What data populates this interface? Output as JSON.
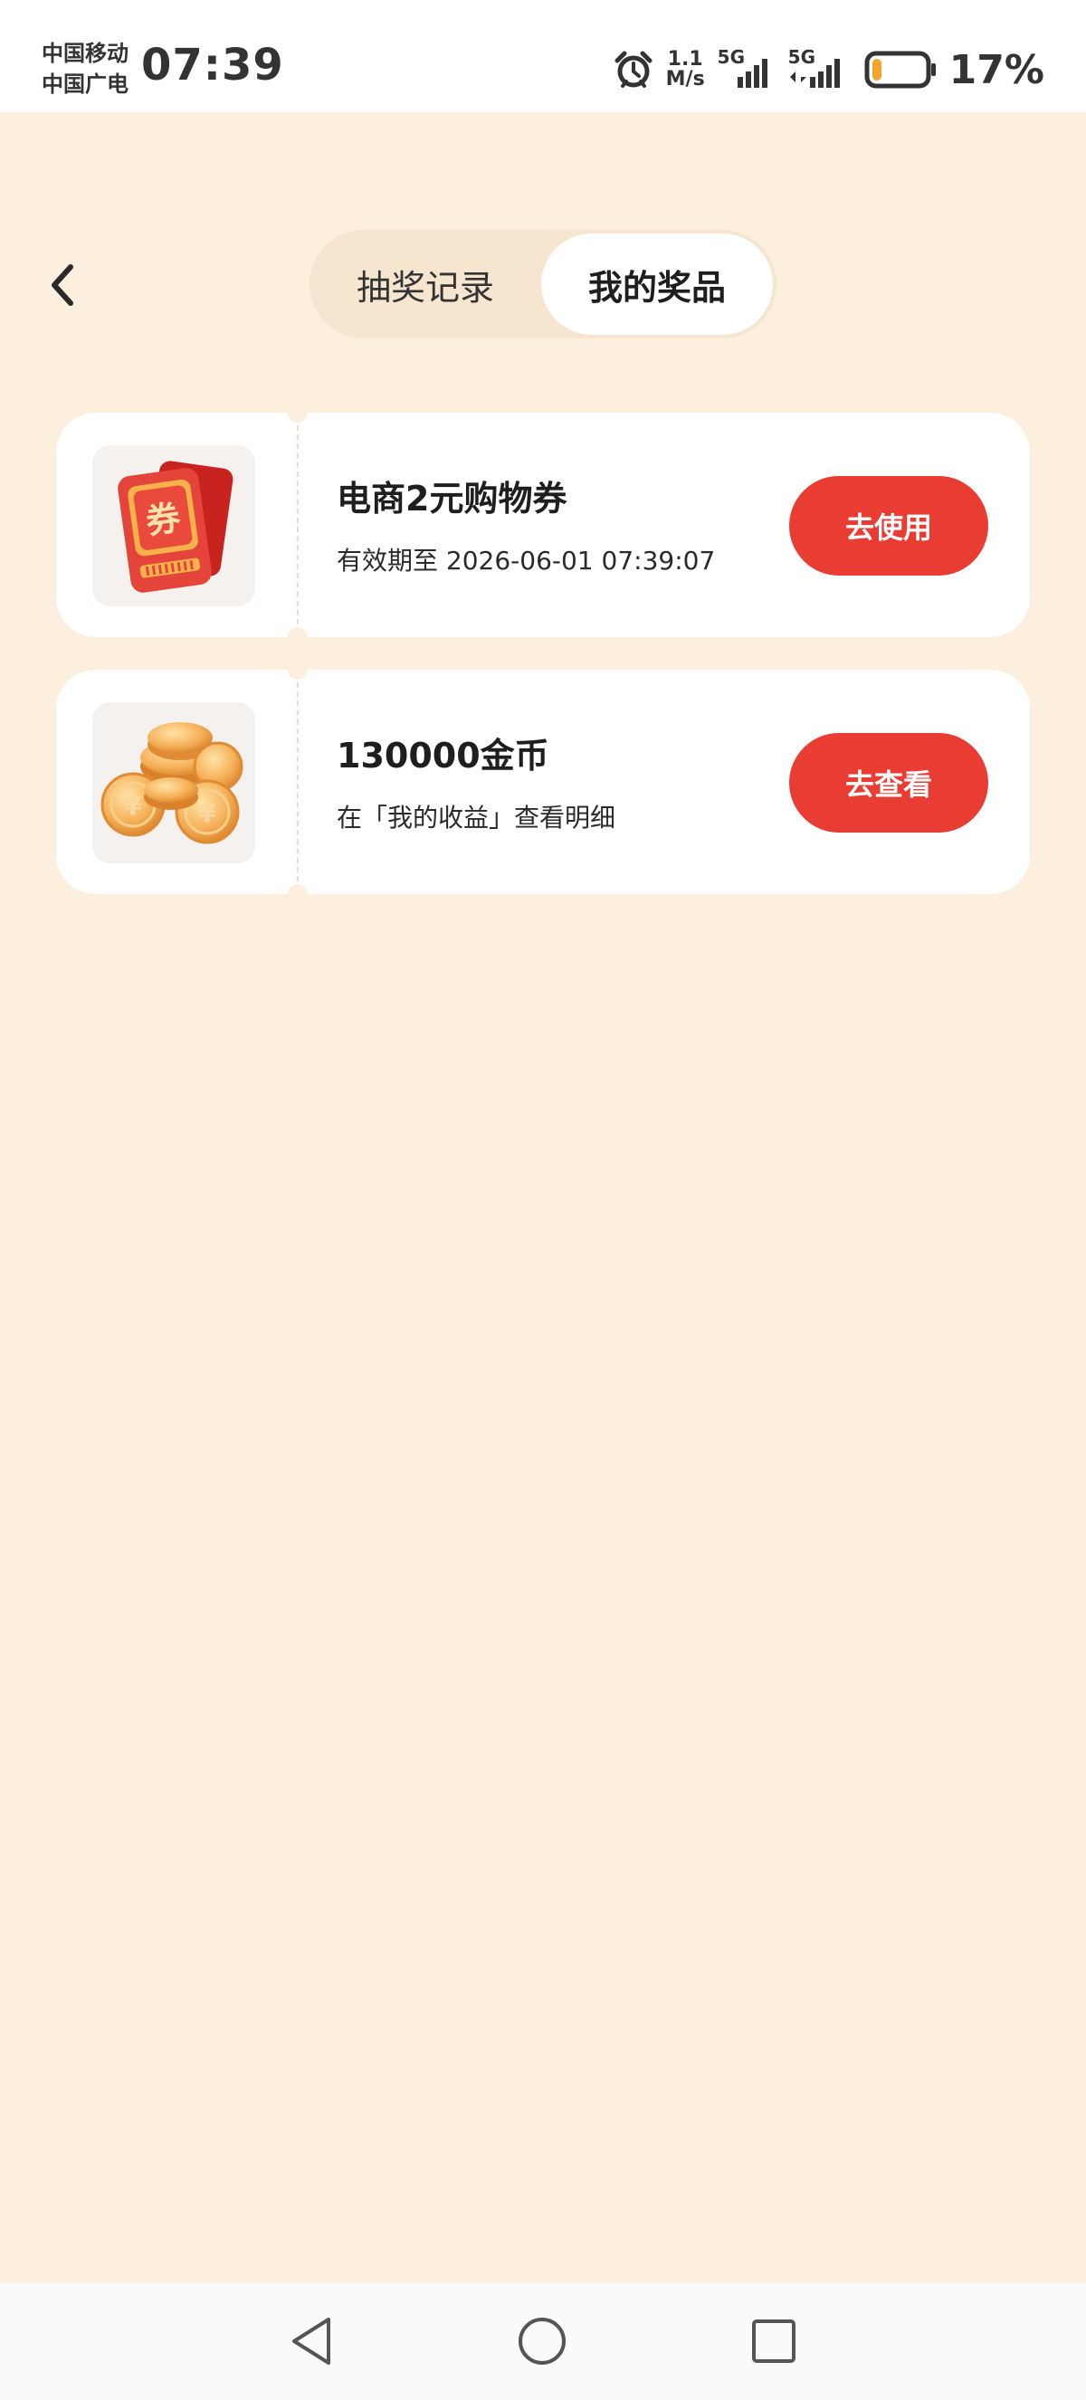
{
  "status_bar": {
    "carrier_1": "中国移动",
    "carrier_2": "中国广电",
    "time": "07:39",
    "net_speed_value": "1.1",
    "net_speed_unit": "M/s",
    "signal_1": "5G",
    "signal_2": "5G",
    "battery_percent": "17%",
    "battery_level": 0.17,
    "battery_color": "#f4a62a",
    "icons": [
      "alarm-icon",
      "signal-icon",
      "battery-icon"
    ]
  },
  "header": {
    "back_icon": "chevron-left-icon",
    "tabs": [
      {
        "label": "抽奖记录",
        "active": false
      },
      {
        "label": "我的奖品",
        "active": true
      }
    ]
  },
  "prizes": [
    {
      "icon": "coupon-icon",
      "title": "电商2元购物券",
      "subtitle": "有效期至 2026-06-01 07:39:07",
      "button": "去使用"
    },
    {
      "icon": "gold-coins-icon",
      "title": "130000金币",
      "subtitle": "在「我的收益」查看明细",
      "button": "去查看"
    }
  ],
  "nav_bar": {
    "icons": [
      "nav-back-icon",
      "nav-home-icon",
      "nav-recents-icon"
    ]
  },
  "colors": {
    "page_bg": "#fcefdd",
    "accent_red": "#e93c33",
    "tab_track": "#f6e6cf",
    "card_bg": "#ffffff"
  }
}
